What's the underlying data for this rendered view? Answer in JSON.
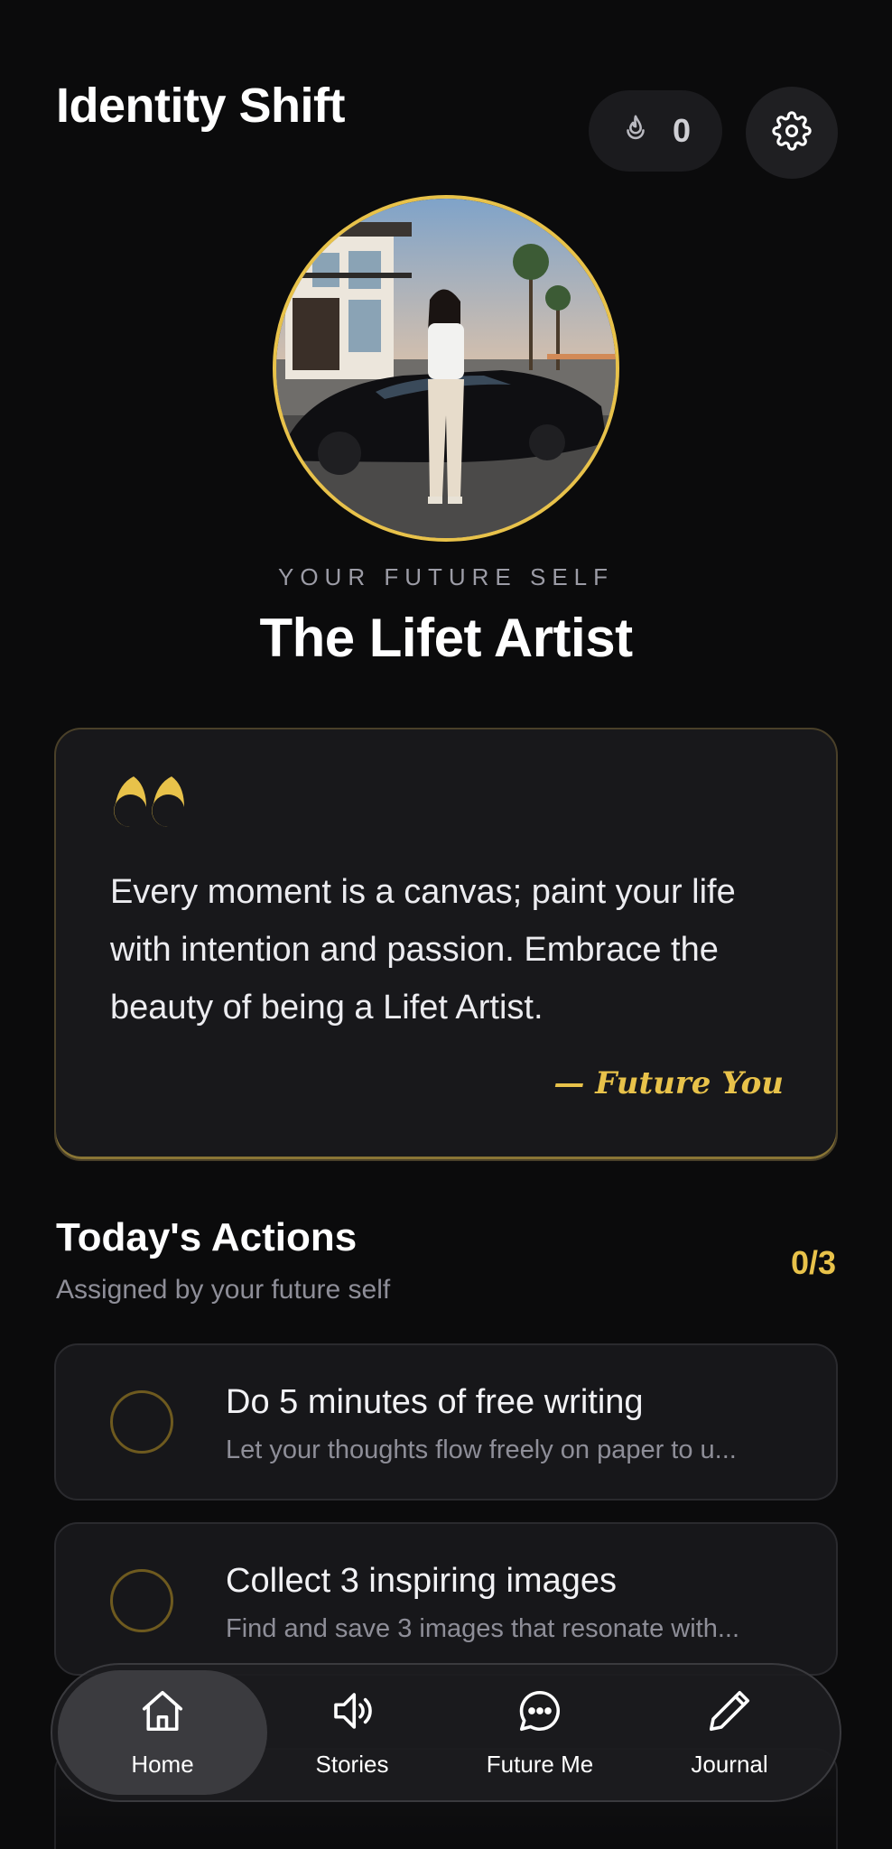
{
  "header": {
    "title": "Identity Shift",
    "streak_count": "0",
    "streak_icon": "flame-icon",
    "settings_icon": "gear-icon"
  },
  "profile": {
    "eyebrow": "YOUR FUTURE SELF",
    "name": "The Lifet Artist"
  },
  "quote": {
    "text": "Every moment is a canvas; paint your life with intention and passion. Embrace the beauty of being a Lifet Artist.",
    "author": "— Future You"
  },
  "actions": {
    "title": "Today's Actions",
    "subtitle": "Assigned by your future self",
    "progress": "0/3",
    "items": [
      {
        "title": "Do 5 minutes of free writing",
        "desc": "Let your thoughts flow freely on paper to u..."
      },
      {
        "title": "Collect 3 inspiring images",
        "desc": "Find and save 3 images that resonate with..."
      }
    ]
  },
  "nav": {
    "items": [
      {
        "label": "Home",
        "icon": "home-icon",
        "active": true
      },
      {
        "label": "Stories",
        "icon": "speaker-icon",
        "active": false
      },
      {
        "label": "Future Me",
        "icon": "chat-icon",
        "active": false
      },
      {
        "label": "Journal",
        "icon": "pencil-icon",
        "active": false
      }
    ]
  },
  "colors": {
    "accent": "#e8c24a",
    "background": "#0b0b0c",
    "card": "#17171a"
  }
}
